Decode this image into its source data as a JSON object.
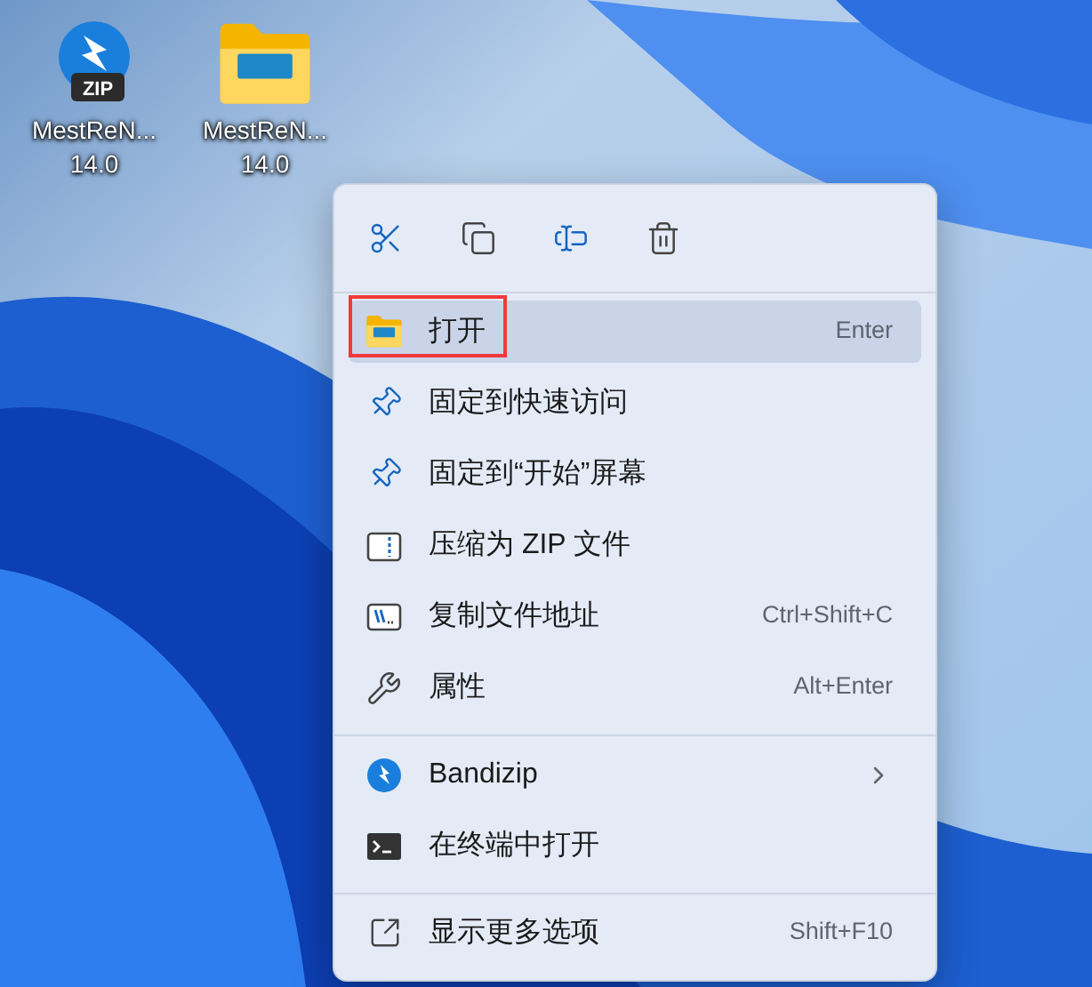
{
  "desktop_icons": [
    {
      "kind": "zip",
      "badge": "ZIP",
      "label": "MestReN...",
      "version": "14.0"
    },
    {
      "kind": "folder",
      "label": "MestReN...",
      "version": "14.0"
    }
  ],
  "context_menu": {
    "toolbar": [
      {
        "kind": "cut"
      },
      {
        "kind": "copy"
      },
      {
        "kind": "rename"
      },
      {
        "kind": "delete"
      }
    ],
    "groups": [
      [
        {
          "kind": "folder",
          "label": "打开",
          "shortcut": "Enter",
          "selected": true,
          "annotated": true,
          "submenu": false
        },
        {
          "kind": "pin",
          "label": "固定到快速访问",
          "selected": false,
          "annotated": false,
          "submenu": false
        },
        {
          "kind": "pin",
          "label": "固定到“开始”屏幕",
          "selected": false,
          "annotated": false,
          "submenu": false
        },
        {
          "kind": "zip",
          "label": "压缩为 ZIP 文件",
          "selected": false,
          "annotated": false,
          "submenu": false
        },
        {
          "kind": "path",
          "label": "复制文件地址",
          "shortcut": "Ctrl+Shift+C",
          "selected": false,
          "annotated": false,
          "submenu": false
        },
        {
          "kind": "wrench",
          "label": "属性",
          "shortcut": "Alt+Enter",
          "selected": false,
          "annotated": false,
          "submenu": false
        }
      ],
      [
        {
          "kind": "bandizip",
          "label": "Bandizip",
          "selected": false,
          "annotated": false,
          "submenu": true
        },
        {
          "kind": "terminal",
          "label": "在终端中打开",
          "selected": false,
          "annotated": false,
          "submenu": false
        }
      ],
      [
        {
          "kind": "more",
          "label": "显示更多选项",
          "shortcut": "Shift+F10",
          "selected": false,
          "annotated": false,
          "submenu": false
        }
      ]
    ]
  }
}
